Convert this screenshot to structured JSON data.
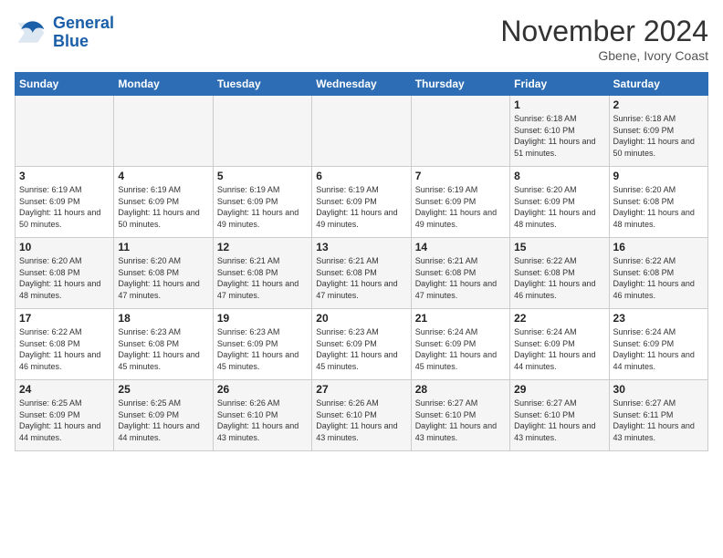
{
  "logo": {
    "line1": "General",
    "line2": "Blue"
  },
  "title": "November 2024",
  "location": "Gbene, Ivory Coast",
  "days_of_week": [
    "Sunday",
    "Monday",
    "Tuesday",
    "Wednesday",
    "Thursday",
    "Friday",
    "Saturday"
  ],
  "weeks": [
    [
      {
        "day": "",
        "info": ""
      },
      {
        "day": "",
        "info": ""
      },
      {
        "day": "",
        "info": ""
      },
      {
        "day": "",
        "info": ""
      },
      {
        "day": "",
        "info": ""
      },
      {
        "day": "1",
        "info": "Sunrise: 6:18 AM\nSunset: 6:10 PM\nDaylight: 11 hours and 51 minutes."
      },
      {
        "day": "2",
        "info": "Sunrise: 6:18 AM\nSunset: 6:09 PM\nDaylight: 11 hours and 50 minutes."
      }
    ],
    [
      {
        "day": "3",
        "info": "Sunrise: 6:19 AM\nSunset: 6:09 PM\nDaylight: 11 hours and 50 minutes."
      },
      {
        "day": "4",
        "info": "Sunrise: 6:19 AM\nSunset: 6:09 PM\nDaylight: 11 hours and 50 minutes."
      },
      {
        "day": "5",
        "info": "Sunrise: 6:19 AM\nSunset: 6:09 PM\nDaylight: 11 hours and 49 minutes."
      },
      {
        "day": "6",
        "info": "Sunrise: 6:19 AM\nSunset: 6:09 PM\nDaylight: 11 hours and 49 minutes."
      },
      {
        "day": "7",
        "info": "Sunrise: 6:19 AM\nSunset: 6:09 PM\nDaylight: 11 hours and 49 minutes."
      },
      {
        "day": "8",
        "info": "Sunrise: 6:20 AM\nSunset: 6:09 PM\nDaylight: 11 hours and 48 minutes."
      },
      {
        "day": "9",
        "info": "Sunrise: 6:20 AM\nSunset: 6:08 PM\nDaylight: 11 hours and 48 minutes."
      }
    ],
    [
      {
        "day": "10",
        "info": "Sunrise: 6:20 AM\nSunset: 6:08 PM\nDaylight: 11 hours and 48 minutes."
      },
      {
        "day": "11",
        "info": "Sunrise: 6:20 AM\nSunset: 6:08 PM\nDaylight: 11 hours and 47 minutes."
      },
      {
        "day": "12",
        "info": "Sunrise: 6:21 AM\nSunset: 6:08 PM\nDaylight: 11 hours and 47 minutes."
      },
      {
        "day": "13",
        "info": "Sunrise: 6:21 AM\nSunset: 6:08 PM\nDaylight: 11 hours and 47 minutes."
      },
      {
        "day": "14",
        "info": "Sunrise: 6:21 AM\nSunset: 6:08 PM\nDaylight: 11 hours and 47 minutes."
      },
      {
        "day": "15",
        "info": "Sunrise: 6:22 AM\nSunset: 6:08 PM\nDaylight: 11 hours and 46 minutes."
      },
      {
        "day": "16",
        "info": "Sunrise: 6:22 AM\nSunset: 6:08 PM\nDaylight: 11 hours and 46 minutes."
      }
    ],
    [
      {
        "day": "17",
        "info": "Sunrise: 6:22 AM\nSunset: 6:08 PM\nDaylight: 11 hours and 46 minutes."
      },
      {
        "day": "18",
        "info": "Sunrise: 6:23 AM\nSunset: 6:08 PM\nDaylight: 11 hours and 45 minutes."
      },
      {
        "day": "19",
        "info": "Sunrise: 6:23 AM\nSunset: 6:09 PM\nDaylight: 11 hours and 45 minutes."
      },
      {
        "day": "20",
        "info": "Sunrise: 6:23 AM\nSunset: 6:09 PM\nDaylight: 11 hours and 45 minutes."
      },
      {
        "day": "21",
        "info": "Sunrise: 6:24 AM\nSunset: 6:09 PM\nDaylight: 11 hours and 45 minutes."
      },
      {
        "day": "22",
        "info": "Sunrise: 6:24 AM\nSunset: 6:09 PM\nDaylight: 11 hours and 44 minutes."
      },
      {
        "day": "23",
        "info": "Sunrise: 6:24 AM\nSunset: 6:09 PM\nDaylight: 11 hours and 44 minutes."
      }
    ],
    [
      {
        "day": "24",
        "info": "Sunrise: 6:25 AM\nSunset: 6:09 PM\nDaylight: 11 hours and 44 minutes."
      },
      {
        "day": "25",
        "info": "Sunrise: 6:25 AM\nSunset: 6:09 PM\nDaylight: 11 hours and 44 minutes."
      },
      {
        "day": "26",
        "info": "Sunrise: 6:26 AM\nSunset: 6:10 PM\nDaylight: 11 hours and 43 minutes."
      },
      {
        "day": "27",
        "info": "Sunrise: 6:26 AM\nSunset: 6:10 PM\nDaylight: 11 hours and 43 minutes."
      },
      {
        "day": "28",
        "info": "Sunrise: 6:27 AM\nSunset: 6:10 PM\nDaylight: 11 hours and 43 minutes."
      },
      {
        "day": "29",
        "info": "Sunrise: 6:27 AM\nSunset: 6:10 PM\nDaylight: 11 hours and 43 minutes."
      },
      {
        "day": "30",
        "info": "Sunrise: 6:27 AM\nSunset: 6:11 PM\nDaylight: 11 hours and 43 minutes."
      }
    ]
  ]
}
